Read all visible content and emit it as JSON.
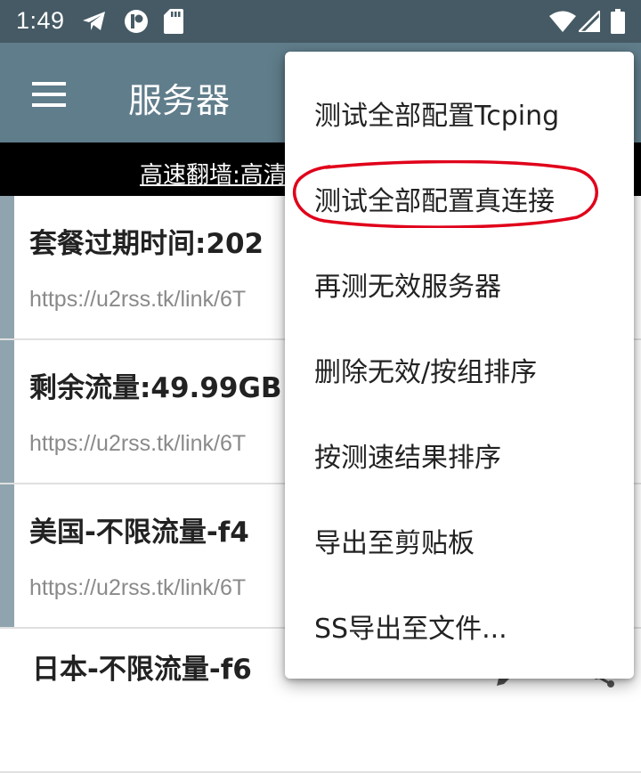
{
  "status_bar": {
    "time": "1:49",
    "icons_left": [
      "telegram-icon",
      "app-badge-icon",
      "sd-card-icon"
    ],
    "icons_right": [
      "wifi-icon",
      "signal-icon",
      "battery-icon"
    ]
  },
  "app_bar": {
    "title": "服务器",
    "menu_icon": "hamburger-menu-icon"
  },
  "banner": {
    "text": "高速翻墙:高清"
  },
  "servers": [
    {
      "title": "套餐过期时间:202",
      "url": "https://u2rss.tk/link/6T"
    },
    {
      "title": "剩余流量:49.99GB",
      "url": "https://u2rss.tk/link/6T"
    },
    {
      "title": "美国-不限流量-f4",
      "url": "https://u2rss.tk/link/6T"
    },
    {
      "title": "日本-不限流量-f6",
      "url": ""
    }
  ],
  "menu": {
    "items": [
      {
        "label": "测试全部配置Tcping"
      },
      {
        "label": "测试全部配置真连接",
        "highlighted": true
      },
      {
        "label": "再测无效服务器"
      },
      {
        "label": "删除无效/按组排序"
      },
      {
        "label": "按测速结果排序"
      },
      {
        "label": "导出至剪贴板"
      },
      {
        "label": "SS导出至文件..."
      }
    ]
  },
  "colors": {
    "status_bar": "#455a64",
    "app_bar": "#607d8b",
    "banner_bg": "#000000",
    "row_accent": "#8fa4ae",
    "highlight_annotation": "#e0001a"
  }
}
